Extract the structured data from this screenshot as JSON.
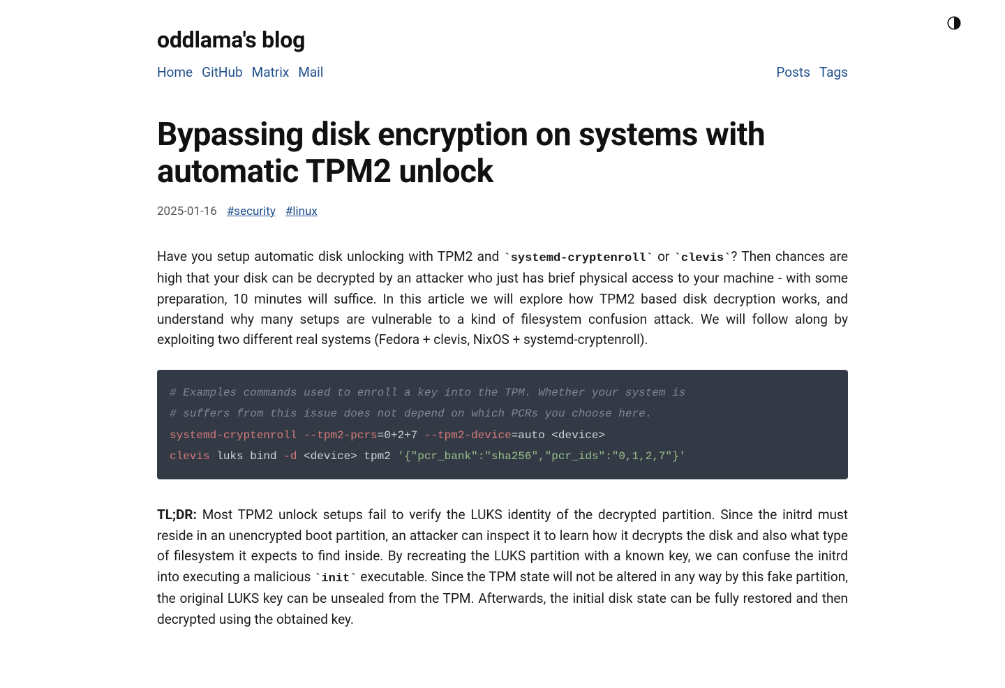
{
  "site": {
    "title": "oddlama's blog"
  },
  "nav": {
    "left": [
      "Home",
      "GitHub",
      "Matrix",
      "Mail"
    ],
    "right": [
      "Posts",
      "Tags"
    ]
  },
  "post": {
    "title": "Bypassing disk encryption on systems with automatic TPM2 unlock",
    "date": "2025-01-16",
    "tags": [
      "#security",
      "#linux"
    ]
  },
  "intro": {
    "pre1": "Have you setup automatic disk unlocking with TPM2 and ",
    "code1": "`systemd-cryptenroll`",
    "mid1": " or ",
    "code2": "`clevis`",
    "post1": "? Then chances are high that your disk can be decrypted by an attacker who just has brief physical access to your machine - with some preparation, 10 minutes will suffice. In this article we will explore how TPM2 based disk decryption works, and understand why many setups are vulnerable to a kind of filesystem confusion attack. We will follow along by exploiting two different real systems (Fedora + clevis, NixOS + systemd-cryptenroll)."
  },
  "code": {
    "comment1": "# Examples commands used to enroll a key into the TPM. Whether your system is",
    "comment2": "# suffers from this issue does not depend on which PCRs you choose here.",
    "l1_cmd": "systemd-cryptenroll",
    "l1_flag1": " --tpm2-pcrs",
    "l1_eq1": "=0+2+7",
    "l1_flag2": " --tpm2-device",
    "l1_eq2": "=auto <device>",
    "l2_cmd": "clevis",
    "l2_plain1": " luks bind ",
    "l2_flag1": "-d",
    "l2_plain2": " <device> tpm2 ",
    "l2_str": "'{\"pcr_bank\":\"sha256\",\"pcr_ids\":\"0,1,2,7\"}'"
  },
  "tldr": {
    "label": "TL;DR:",
    "pre": " Most TPM2 unlock setups fail to verify the LUKS identity of the decrypted partition. Since the initrd must reside in an unencrypted boot partition, an attacker can inspect it to learn how it decrypts the disk and also what type of filesystem it expects to find inside. By recreating the LUKS partition with a known key, we can confuse the initrd into executing a malicious ",
    "code": "`init`",
    "post": " executable. Since the TPM state will not be altered in any way by this fake partition, the original LUKS key can be unsealed from the TPM. Afterwards, the initial disk state can be fully restored and then decrypted using the obtained key."
  }
}
